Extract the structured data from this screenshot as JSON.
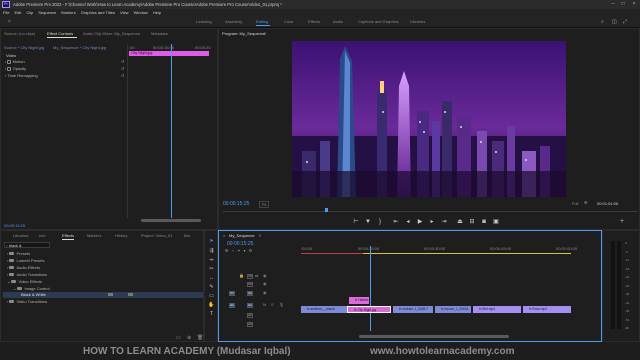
{
  "window": {
    "title": "Adobe Premiere Pro 2022 - F:\\Channel Work\\How to Learn Academy\\Adobe Premiere Pro Course\\Adobe Premiere Pro Course\\Video_01.prproj *",
    "logo": "Pr"
  },
  "menu": [
    "File",
    "Edit",
    "Clip",
    "Sequence",
    "Markers",
    "Graphics and Titles",
    "View",
    "Window",
    "Help"
  ],
  "workspaces": [
    "Learning",
    "Assembly",
    "Editing",
    "Color",
    "Effects",
    "Audio",
    "Captions and Graphics",
    "Libraries"
  ],
  "workspace_active": "Editing",
  "source_panel": {
    "tabs": [
      "Source: (no clips)",
      "Effect Controls",
      "Audio Clip Mixer: My_Sequence",
      "Metadata"
    ],
    "active_tab": "Effect Controls",
    "clip_selector": "Source * City Night.jpg",
    "sequence_selector": "My_Sequence * City Night.jpg",
    "ruler_left": ":00",
    "ruler_mid": "00:00:15:00",
    "ruler_right": "00:00:20",
    "clip_label": "City Night.jpg",
    "section": "Video",
    "rows": [
      "Motion",
      "Opacity",
      "Time Remapping"
    ],
    "timecode": "00:00:15:25"
  },
  "program_monitor": {
    "title": "Program: My_Sequence",
    "timecode": "00:00:15:25",
    "fit": "Fit",
    "quality": "Full",
    "duration": "00:01:01:06"
  },
  "project_panel": {
    "tabs": [
      "Libraries",
      "Info",
      "Effects",
      "Markers",
      "History",
      "Project: Video_01",
      "Brs"
    ],
    "active_tab": "Effects",
    "search_value": "black & ",
    "tree": [
      {
        "label": "Presets",
        "indent": 1
      },
      {
        "label": "Lumetri Presets",
        "indent": 1
      },
      {
        "label": "Audio Effects",
        "indent": 1
      },
      {
        "label": "Audio Transitions",
        "indent": 1
      },
      {
        "label": "Video Effects",
        "indent": 1
      },
      {
        "label": "Image Control",
        "indent": 2
      },
      {
        "label": "Black & White",
        "indent": 3
      },
      {
        "label": "Video Transitions",
        "indent": 1
      }
    ]
  },
  "timeline": {
    "title": "My_Sequence",
    "timecode": "00:00:15:25",
    "ruler": [
      ":00:00",
      "00:00:15:00",
      "00:00:30:00",
      "00:00:45:00",
      "00:01:00:00"
    ],
    "tracks": [
      "V3",
      "V2",
      "V1",
      "A1",
      "A2",
      "A3"
    ],
    "source_patch": [
      "V1",
      "A1"
    ],
    "clips_v2": [
      {
        "label": "fx  Halsed"
      }
    ],
    "clips_v1": [
      {
        "label": "fx  amtmos_-_wandi",
        "color": "blue"
      },
      {
        "label": "fx  City Night.jpg",
        "color": "pink"
      },
      {
        "label": "fx  motrain_1_0685-7",
        "color": "blue"
      },
      {
        "label": "fx  repose_1_00634",
        "color": "blue"
      },
      {
        "label": "fx  Bhit.mp4",
        "color": "violet"
      },
      {
        "label": "fx  Rosa.mp4",
        "color": "violet"
      }
    ],
    "vu_scale": [
      "0",
      "-6",
      "-12",
      "-18",
      "-24",
      "-30",
      "-36",
      "-42",
      "-48",
      "-54",
      "dB"
    ]
  },
  "footer": {
    "left": "HOW TO LEARN ACADEMY (Mudasar Iqbal)",
    "right": "www.howtolearnacademy.com"
  }
}
